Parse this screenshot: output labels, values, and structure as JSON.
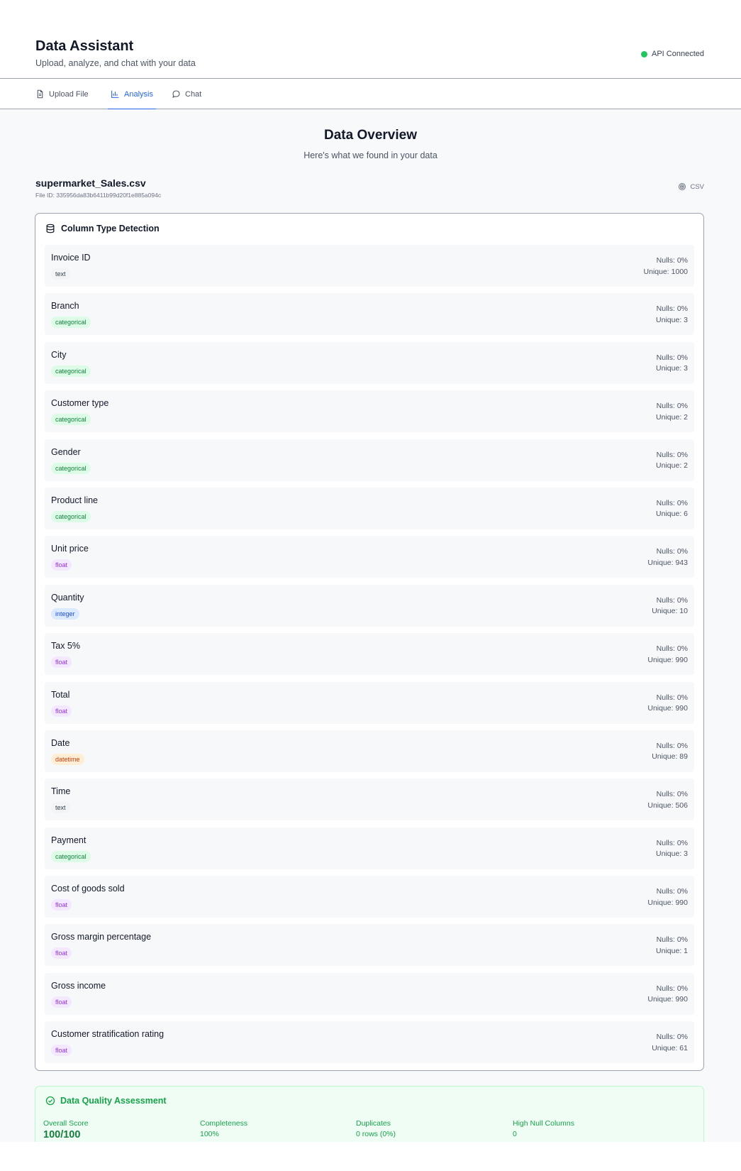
{
  "header": {
    "title": "Data Assistant",
    "subtitle": "Upload, analyze, and chat with your data",
    "api_status": "API Connected",
    "api_status_color": "#22c55e"
  },
  "tabs": [
    {
      "label": "Upload File",
      "icon": "file-icon",
      "active": false
    },
    {
      "label": "Analysis",
      "icon": "bar-chart-icon",
      "active": true
    },
    {
      "label": "Chat",
      "icon": "chat-bubble-icon",
      "active": false
    }
  ],
  "overview": {
    "title": "Data Overview",
    "subtitle": "Here's what we found in your data"
  },
  "file": {
    "name": "supermarket_Sales.csv",
    "id_text": "File ID: 335956da83b6411b99d20f1e885a094c",
    "type": "CSV"
  },
  "column_detection": {
    "title": "Column Type Detection",
    "columns": [
      {
        "name": "Invoice ID",
        "type": "text",
        "nulls": "Nulls: 0%",
        "unique": "Unique: 1000"
      },
      {
        "name": "Branch",
        "type": "categorical",
        "nulls": "Nulls: 0%",
        "unique": "Unique: 3"
      },
      {
        "name": "City",
        "type": "categorical",
        "nulls": "Nulls: 0%",
        "unique": "Unique: 3"
      },
      {
        "name": "Customer type",
        "type": "categorical",
        "nulls": "Nulls: 0%",
        "unique": "Unique: 2"
      },
      {
        "name": "Gender",
        "type": "categorical",
        "nulls": "Nulls: 0%",
        "unique": "Unique: 2"
      },
      {
        "name": "Product line",
        "type": "categorical",
        "nulls": "Nulls: 0%",
        "unique": "Unique: 6"
      },
      {
        "name": "Unit price",
        "type": "float",
        "nulls": "Nulls: 0%",
        "unique": "Unique: 943"
      },
      {
        "name": "Quantity",
        "type": "integer",
        "nulls": "Nulls: 0%",
        "unique": "Unique: 10"
      },
      {
        "name": "Tax 5%",
        "type": "float",
        "nulls": "Nulls: 0%",
        "unique": "Unique: 990"
      },
      {
        "name": "Total",
        "type": "float",
        "nulls": "Nulls: 0%",
        "unique": "Unique: 990"
      },
      {
        "name": "Date",
        "type": "datetime",
        "nulls": "Nulls: 0%",
        "unique": "Unique: 89"
      },
      {
        "name": "Time",
        "type": "text",
        "nulls": "Nulls: 0%",
        "unique": "Unique: 506"
      },
      {
        "name": "Payment",
        "type": "categorical",
        "nulls": "Nulls: 0%",
        "unique": "Unique: 3"
      },
      {
        "name": "Cost of goods sold",
        "type": "float",
        "nulls": "Nulls: 0%",
        "unique": "Unique: 990"
      },
      {
        "name": "Gross margin percentage",
        "type": "float",
        "nulls": "Nulls: 0%",
        "unique": "Unique: 1"
      },
      {
        "name": "Gross income",
        "type": "float",
        "nulls": "Nulls: 0%",
        "unique": "Unique: 990"
      },
      {
        "name": "Customer stratification rating",
        "type": "float",
        "nulls": "Nulls: 0%",
        "unique": "Unique: 61"
      }
    ]
  },
  "quality": {
    "title": "Data Quality Assessment",
    "metrics": [
      {
        "label": "Overall Score",
        "value": "100/100"
      },
      {
        "label": "Completeness",
        "value": "100%"
      },
      {
        "label": "Duplicates",
        "value": "0 rows (0%)"
      },
      {
        "label": "High Null Columns",
        "value": "0"
      }
    ]
  },
  "colors": {
    "accent": "#2563eb",
    "success": "#16a34a",
    "badge_text": "#f3f4f6",
    "badge_categorical": "#dcfce7",
    "badge_float": "#f3e8ff",
    "badge_integer": "#dbeafe",
    "badge_datetime": "#ffedd5"
  }
}
